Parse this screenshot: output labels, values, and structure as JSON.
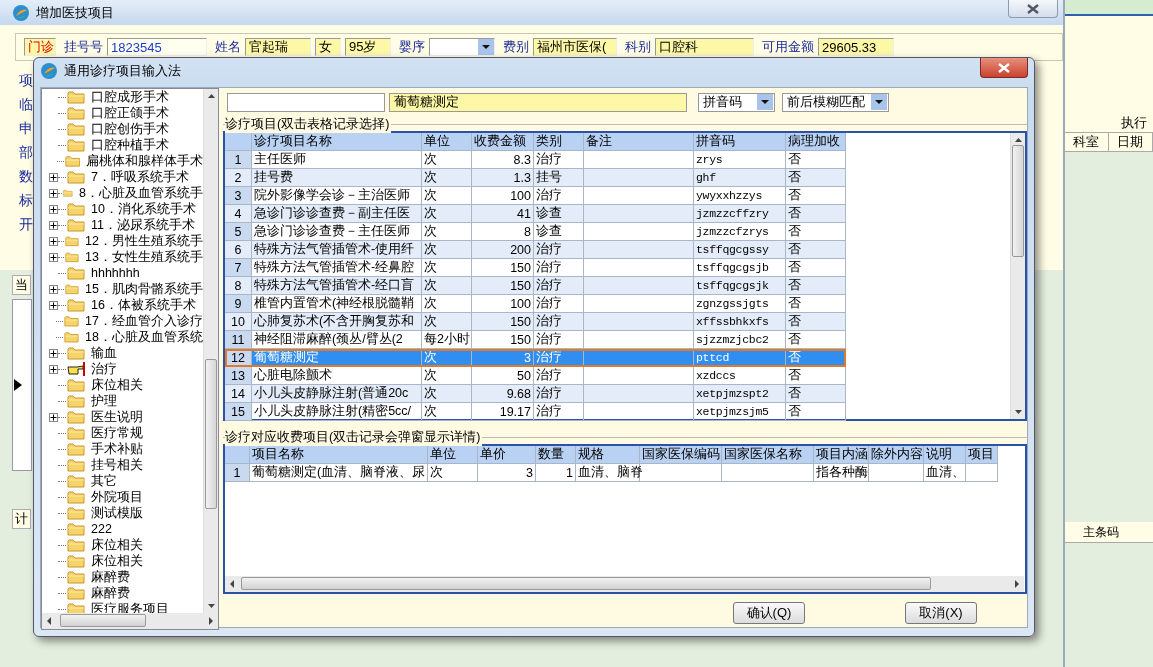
{
  "main_window": {
    "title": "增加医技项目",
    "visit_type": "门诊",
    "fields": [
      {
        "label": "挂号号",
        "value": "1823545",
        "kind": "number"
      },
      {
        "label": "姓名",
        "value": "官起瑞",
        "kind": "text"
      },
      {
        "value": "女",
        "kind": "text"
      },
      {
        "value": "95岁",
        "kind": "text"
      },
      {
        "label": "婴序",
        "kind": "dropdown"
      },
      {
        "label": "费别",
        "value": "福州市医保(",
        "kind": "text"
      },
      {
        "label": "科别",
        "value": "口腔科",
        "kind": "text"
      },
      {
        "label": "可用金额",
        "value": "29605.33",
        "kind": "text"
      }
    ],
    "side_labels": [
      "项",
      "临",
      "申",
      "部",
      "数",
      "标",
      "开"
    ],
    "lower_tabs": [
      "当",
      "计"
    ]
  },
  "right_panel": {
    "header": "执行",
    "columns": [
      "科室",
      "日期"
    ],
    "footer_header": "主条码"
  },
  "dialog": {
    "title": "通用诊疗项目输入法",
    "tree": [
      {
        "label": "口腔成形手术",
        "expandable": false,
        "kind": "folder"
      },
      {
        "label": "口腔正颌手术",
        "expandable": false,
        "kind": "folder"
      },
      {
        "label": "口腔创伤手术",
        "expandable": false,
        "kind": "folder"
      },
      {
        "label": "口腔种植手术",
        "expandable": false,
        "kind": "folder"
      },
      {
        "label": "扁桃体和腺样体手术",
        "expandable": false,
        "kind": "folder"
      },
      {
        "label": "7．呼吸系统手术",
        "expandable": true,
        "kind": "folder"
      },
      {
        "label": "8．心脏及血管系统手",
        "expandable": true,
        "kind": "folder"
      },
      {
        "label": "10．消化系统手术",
        "expandable": true,
        "kind": "folder"
      },
      {
        "label": "11．泌尿系统手术",
        "expandable": true,
        "kind": "folder"
      },
      {
        "label": "12．男性生殖系统手",
        "expandable": true,
        "kind": "folder"
      },
      {
        "label": "13．女性生殖系统手",
        "expandable": true,
        "kind": "folder"
      },
      {
        "label": "hhhhhhh",
        "expandable": false,
        "kind": "folder"
      },
      {
        "label": "15．肌肉骨骼系统手",
        "expandable": true,
        "kind": "folder"
      },
      {
        "label": "16．体被系统手术",
        "expandable": true,
        "kind": "folder"
      },
      {
        "label": "17．经血管介入诊疗",
        "expandable": false,
        "kind": "folder"
      },
      {
        "label": "18．心脏及血管系统",
        "expandable": false,
        "kind": "folder"
      },
      {
        "label": "输血",
        "expandable": true,
        "kind": "folder"
      },
      {
        "label": "治疗",
        "expandable": true,
        "kind": "pointer"
      },
      {
        "label": "床位相关",
        "expandable": false,
        "kind": "folder"
      },
      {
        "label": "护理",
        "expandable": false,
        "kind": "folder"
      },
      {
        "label": "医生说明",
        "expandable": true,
        "kind": "folder"
      },
      {
        "label": "医疗常规",
        "expandable": false,
        "kind": "folder"
      },
      {
        "label": "手术补贴",
        "expandable": false,
        "kind": "folder"
      },
      {
        "label": "挂号相关",
        "expandable": false,
        "kind": "folder"
      },
      {
        "label": "其它",
        "expandable": false,
        "kind": "folder"
      },
      {
        "label": "外院项目",
        "expandable": false,
        "kind": "folder"
      },
      {
        "label": "测试模版",
        "expandable": false,
        "kind": "folder"
      },
      {
        "label": "222",
        "expandable": false,
        "kind": "folder"
      },
      {
        "label": "床位相关",
        "expandable": false,
        "kind": "folder"
      },
      {
        "label": "床位相关",
        "expandable": false,
        "kind": "folder"
      },
      {
        "label": "麻醉费",
        "expandable": false,
        "kind": "folder"
      },
      {
        "label": "麻醉费",
        "expandable": false,
        "kind": "folder"
      },
      {
        "label": "医疗服务项目",
        "expandable": false,
        "kind": "folder"
      }
    ],
    "name_field": {
      "value": "葡萄糖测定"
    },
    "dropdowns": [
      {
        "value": "拼音码"
      },
      {
        "value": "前后模糊匹配"
      }
    ],
    "items_table": {
      "title": "诊疗项目(双击表格记录选择)",
      "columns": [
        "诊疗项目名称",
        "单位",
        "收费金额",
        "类别",
        "备注",
        "拼音码",
        "病理加收"
      ],
      "rows": [
        {
          "number": "1",
          "cells": [
            "主任医师",
            "次",
            "8.3",
            "治疗",
            "",
            "zrys",
            "否"
          ],
          "selected": false
        },
        {
          "number": "2",
          "cells": [
            "挂号费",
            "次",
            "1.3",
            "挂号",
            "",
            "ghf",
            "否"
          ],
          "selected": false
        },
        {
          "number": "3",
          "cells": [
            "院外影像学会诊－主治医师",
            "次",
            "100",
            "治疗",
            "",
            "ywyxxhzzys",
            "否"
          ],
          "selected": false
        },
        {
          "number": "4",
          "cells": [
            "急诊门诊诊查费－副主任医",
            "次",
            "41",
            "诊查",
            "",
            "jzmzzcffzry",
            "否"
          ],
          "selected": false
        },
        {
          "number": "5",
          "cells": [
            "急诊门诊诊查费－主任医师",
            "次",
            "8",
            "诊查",
            "",
            "jzmzzcfzrys",
            "否"
          ],
          "selected": false
        },
        {
          "number": "6",
          "cells": [
            "特殊方法气管插管术-使用纤",
            "次",
            "200",
            "治疗",
            "",
            "tsffqgcgssy",
            "否"
          ],
          "selected": false
        },
        {
          "number": "7",
          "cells": [
            "特殊方法气管插管术-经鼻腔",
            "次",
            "150",
            "治疗",
            "",
            "tsffqgcgsjb",
            "否"
          ],
          "selected": false
        },
        {
          "number": "8",
          "cells": [
            "特殊方法气管插管术-经口盲",
            "次",
            "150",
            "治疗",
            "",
            "tsffqgcgsjk",
            "否"
          ],
          "selected": false
        },
        {
          "number": "9",
          "cells": [
            "椎管内置管术(神经根脱髓鞘",
            "次",
            "100",
            "治疗",
            "",
            "zgnzgssjgts",
            "否"
          ],
          "selected": false
        },
        {
          "number": "10",
          "cells": [
            "心肺复苏术(不含开胸复苏和",
            "次",
            "150",
            "治疗",
            "",
            "xffssbhkxfs",
            "否"
          ],
          "selected": false
        },
        {
          "number": "11",
          "cells": [
            "神经阻滞麻醉(颈丛/臂丛(2",
            "每2小时",
            "150",
            "治疗",
            "",
            "sjzzmzjcbc2",
            "否"
          ],
          "selected": false
        },
        {
          "number": "12",
          "cells": [
            "葡萄糖测定",
            "次",
            "3",
            "治疗",
            "",
            "pttcd",
            "否"
          ],
          "selected": true
        },
        {
          "number": "13",
          "cells": [
            "心脏电除颤术",
            "次",
            "50",
            "治疗",
            "",
            "xzdccs",
            "否"
          ],
          "selected": false
        },
        {
          "number": "14",
          "cells": [
            "小儿头皮静脉注射(普通20c",
            "次",
            "9.68",
            "治疗",
            "",
            "xetpjmzspt2",
            "否"
          ],
          "selected": false
        },
        {
          "number": "15",
          "cells": [
            "小儿头皮静脉注射(精密5cc/",
            "次",
            "19.17",
            "治疗",
            "",
            "xetpjmzsjm5",
            "否"
          ],
          "selected": false
        }
      ]
    },
    "charges_table": {
      "title": "诊疗对应收费项目(双击记录会弹窗显示详情)",
      "columns": [
        "项目名称",
        "单位",
        "单价",
        "数量",
        "规格",
        "国家医保编码",
        "国家医保名称",
        "项目内涵",
        "除外内容",
        "说明",
        "项目"
      ],
      "rows": [
        {
          "number": "1",
          "cells": [
            "葡萄糖测定(血清、脑脊液、尿",
            "次",
            "3",
            "1",
            "血清、脑脊",
            "",
            "",
            "指各种酶",
            "",
            "血清、",
            ""
          ],
          "selected": false
        }
      ]
    },
    "buttons": [
      "确认(Q)",
      "取消(X)"
    ]
  }
}
